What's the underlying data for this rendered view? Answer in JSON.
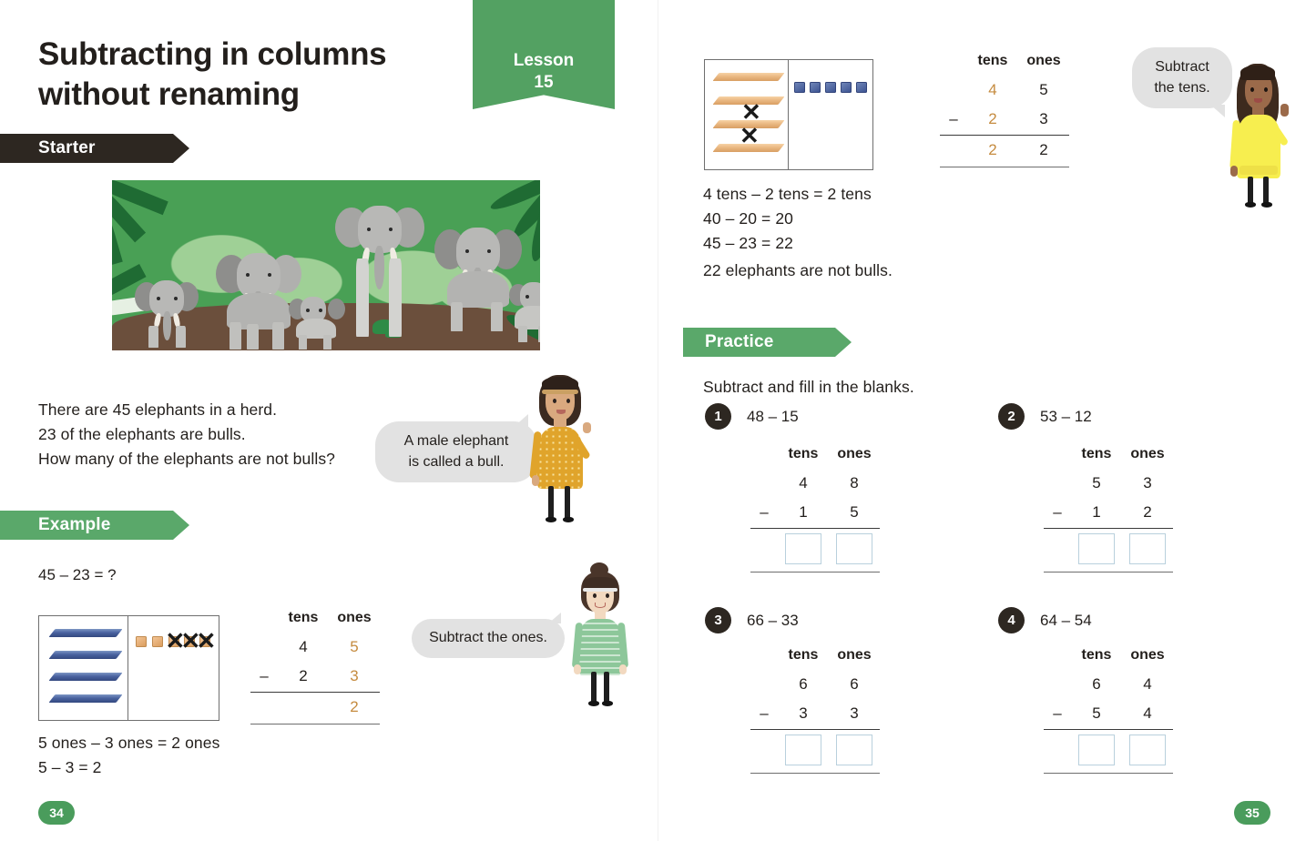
{
  "lesson": {
    "ribbon_label": "Lesson",
    "ribbon_number": "15",
    "title": "Subtracting in columns without renaming"
  },
  "sections": {
    "starter": "Starter",
    "example": "Example",
    "practice": "Practice"
  },
  "starter": {
    "line1": "There are 45 elephants in a herd.",
    "line2": "23 of the elephants are bulls.",
    "line3": "How many of the elephants are not bulls?",
    "bubble": {
      "line1": "A male elephant",
      "line2": "is called a bull."
    },
    "illustration": "elephants-in-jungle-illustration"
  },
  "example": {
    "equation": "45 – 23 =  ?",
    "bubble_ones": "Subtract the ones.",
    "blocks": {
      "tens_count": 4,
      "tens_color": "#4a63a0",
      "ones_count": 5,
      "ones_color": "#da9d5e",
      "ones_crossed": 3
    },
    "sum": {
      "header_tens": "tens",
      "header_ones": "ones",
      "minuend_tens": "4",
      "minuend_ones": "5",
      "operator": "–",
      "subtrahend_tens": "2",
      "subtrahend_ones": "3",
      "result_tens": "",
      "result_ones": "2",
      "highlight_color": "#c58b3f"
    },
    "conclusion_line1": "5 ones – 3 ones = 2 ones",
    "conclusion_line2": "5 – 3 = 2"
  },
  "example_tens": {
    "bubble_tens": {
      "line1": "Subtract",
      "line2": "the tens."
    },
    "blocks": {
      "tens_count": 4,
      "tens_color": "#da9d5e",
      "tens_crossed": 2,
      "ones_count": 5,
      "ones_color": "#3d5492"
    },
    "sum": {
      "header_tens": "tens",
      "header_ones": "ones",
      "minuend_tens": "4",
      "minuend_ones": "5",
      "operator": "–",
      "subtrahend_tens": "2",
      "subtrahend_ones": "3",
      "result_tens": "2",
      "result_ones": "2",
      "highlight_color": "#c58b3f"
    },
    "conclusion_line1": "4 tens – 2 tens = 2 tens",
    "conclusion_line2": "40 – 20 = 20",
    "conclusion_line3": "45 – 23 = 22",
    "statement": "22 elephants are not bulls."
  },
  "practice": {
    "instruction": "Subtract and fill in the blanks.",
    "header_tens": "tens",
    "header_ones": "ones",
    "operator": "–",
    "problems": [
      {
        "number": "1",
        "expression": "48 – 15",
        "minuend_tens": "4",
        "minuend_ones": "8",
        "subtrahend_tens": "1",
        "subtrahend_ones": "5",
        "answer_tens": "",
        "answer_ones": ""
      },
      {
        "number": "2",
        "expression": "53 – 12",
        "minuend_tens": "5",
        "minuend_ones": "3",
        "subtrahend_tens": "1",
        "subtrahend_ones": "2",
        "answer_tens": "",
        "answer_ones": ""
      },
      {
        "number": "3",
        "expression": "66 – 33",
        "minuend_tens": "6",
        "minuend_ones": "6",
        "subtrahend_tens": "3",
        "subtrahend_ones": "3",
        "answer_tens": "",
        "answer_ones": ""
      },
      {
        "number": "4",
        "expression": "64 – 54",
        "minuend_tens": "6",
        "minuend_ones": "4",
        "subtrahend_tens": "5",
        "subtrahend_ones": "4",
        "answer_tens": "",
        "answer_ones": ""
      }
    ]
  },
  "footer": {
    "page_left": "34",
    "page_right": "35"
  },
  "colors": {
    "green_accent": "#53a162",
    "dark_banner": "#2d2721",
    "orange_highlight": "#c58b3f",
    "page_badge_green": "#4a9c5c",
    "bubble_gray": "#e2e2e2"
  },
  "characters": {
    "orange_girl": "girl-in-orange-dress",
    "green_girl": "girl-in-green-dress",
    "yellow_girl": "girl-in-yellow-dress"
  }
}
